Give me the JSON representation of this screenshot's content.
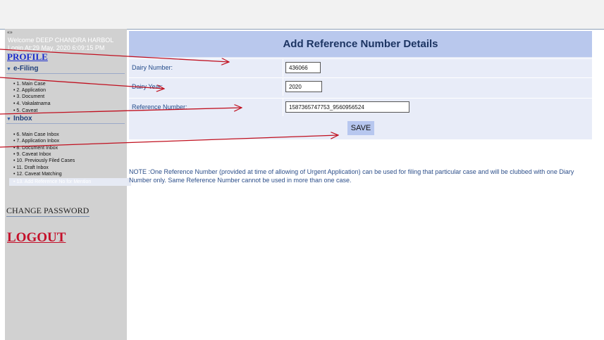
{
  "sidebar": {
    "collapse_glyph": "« »",
    "welcome": "Welcome  DEEP CHANDRA HARBOL",
    "login": "Login At:29 May, 2020 6:09:15 PM",
    "profile": "PROFILE",
    "efiling": {
      "heading": "e-Filing",
      "items": [
        "• 1. Main Case",
        "• 2. Application",
        "• 3. Document",
        "• 4. Vakalatnama",
        "• 5. Caveat"
      ]
    },
    "inbox": {
      "heading": "Inbox",
      "items": [
        "• 6. Main Case Inbox",
        "• 7. Application Inbox",
        "• 8. Document Inbox",
        "• 9. Caveat Inbox",
        "• 10. Previously Filed Cases",
        "• 11. Draft Inbox",
        "• 12. Caveat Matching",
        "• 13. Add Reference No for Mention"
      ]
    },
    "change_password": "CHANGE PASSWORD",
    "logout": "LOGOUT"
  },
  "form": {
    "title": "Add Reference Number Details",
    "diary_number_label": "Dairy Number:",
    "diary_number_value": "436066",
    "diary_year_label": "Dairy Year:",
    "diary_year_value": "2020",
    "reference_label": "Reference Number:",
    "reference_value": "1587365747753_9560956524",
    "save": "SAVE"
  },
  "note": "NOTE :One Reference Number (provided at time of allowing of Urgent Application) can be used for filing that particular case and will be clubbed with one Diary Number only. Same Reference Number cannot be used in more than one case.",
  "colors": {
    "form_header": "#b9c8ed",
    "form_body": "#e8ecf8",
    "annotation_arrow": "#c0101f",
    "logout": "#c4102a",
    "sidebar": "#d1d1d1"
  }
}
